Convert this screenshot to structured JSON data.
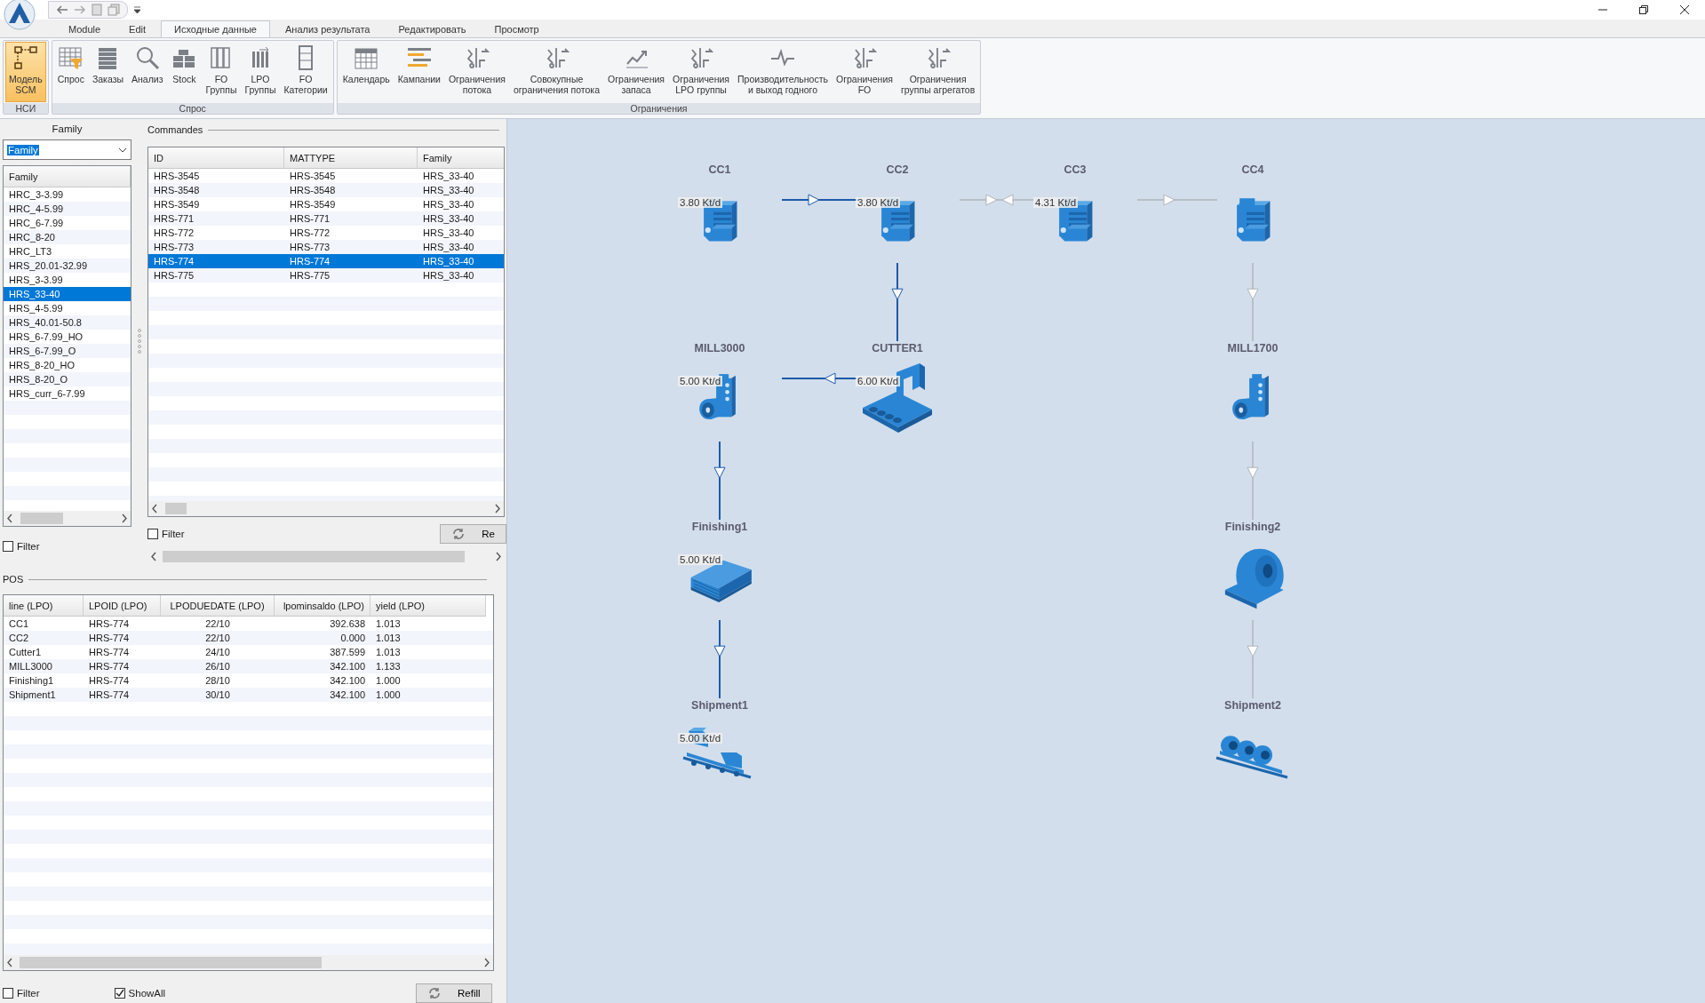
{
  "menu_tabs": [
    {
      "label": "Module",
      "selected": false
    },
    {
      "label": "Edit",
      "selected": false
    },
    {
      "label": "Исходные данные",
      "selected": true
    },
    {
      "label": "Анализ результата",
      "selected": false
    },
    {
      "label": "Редактировать",
      "selected": false
    },
    {
      "label": "Просмотр",
      "selected": false
    }
  ],
  "ribbon_groups": [
    {
      "title": "НСИ",
      "buttons": [
        {
          "kind": "model",
          "lines": [
            "Модель",
            "SCM"
          ],
          "selected": true
        }
      ]
    },
    {
      "title": "Спрос",
      "buttons": [
        {
          "kind": "table",
          "lines": [
            "Спрос"
          ],
          "selected": false
        },
        {
          "kind": "stack",
          "lines": [
            "Заказы"
          ],
          "selected": false
        },
        {
          "kind": "search",
          "lines": [
            "Анализ"
          ],
          "selected": false
        },
        {
          "kind": "stock",
          "lines": [
            "Stock"
          ],
          "selected": false
        },
        {
          "kind": "columns",
          "lines": [
            "FO",
            "Группы"
          ],
          "selected": false
        },
        {
          "kind": "bars",
          "lines": [
            "LPO",
            "Группы"
          ],
          "selected": false
        },
        {
          "kind": "cabinet",
          "lines": [
            "FO",
            "Категории"
          ],
          "selected": false
        }
      ]
    },
    {
      "title": "Ограничения",
      "buttons": [
        {
          "kind": "calendar",
          "lines": [
            "Календарь"
          ],
          "selected": false
        },
        {
          "kind": "gantt",
          "lines": [
            "Кампании"
          ],
          "selected": false
        },
        {
          "kind": "flow",
          "lines": [
            "Ограничения",
            "потока"
          ],
          "selected": false
        },
        {
          "kind": "flow",
          "lines": [
            "Совокупные",
            "ограничения потока"
          ],
          "selected": false
        },
        {
          "kind": "trend",
          "lines": [
            "Ограничения",
            "запаса"
          ],
          "selected": false
        },
        {
          "kind": "flow",
          "lines": [
            "Ограничения",
            "LPO группы"
          ],
          "selected": false
        },
        {
          "kind": "pulse",
          "lines": [
            "Производительность",
            "и выход годного"
          ],
          "selected": false
        },
        {
          "kind": "flow",
          "lines": [
            "Ограничения",
            "FO"
          ],
          "selected": false
        },
        {
          "kind": "flow",
          "lines": [
            "Ограничения",
            "группы агрегатов"
          ],
          "selected": false
        }
      ]
    }
  ],
  "family_panel": {
    "title": "Family",
    "select_value": "Family",
    "list_header": "Family",
    "items": [
      {
        "label": "HRC_3-3.99",
        "selected": false
      },
      {
        "label": "HRC_4-5.99",
        "selected": false
      },
      {
        "label": "HRC_6-7.99",
        "selected": false
      },
      {
        "label": "HRC_8-20",
        "selected": false
      },
      {
        "label": "HRC_LT3",
        "selected": false
      },
      {
        "label": "HRS_20.01-32.99",
        "selected": false
      },
      {
        "label": "HRS_3-3.99",
        "selected": false
      },
      {
        "label": "HRS_33-40",
        "selected": true
      },
      {
        "label": "HRS_4-5.99",
        "selected": false
      },
      {
        "label": "HRS_40.01-50.8",
        "selected": false
      },
      {
        "label": "HRS_6-7.99_HO",
        "selected": false
      },
      {
        "label": "HRS_6-7.99_O",
        "selected": false
      },
      {
        "label": "HRS_8-20_HO",
        "selected": false
      },
      {
        "label": "HRS_8-20_O",
        "selected": false
      },
      {
        "label": "HRS_curr_6-7.99",
        "selected": false
      }
    ],
    "filter": {
      "label": "Filter",
      "checked": false
    }
  },
  "commandes": {
    "title": "Commandes",
    "columns": [
      "ID",
      "MATTYPE",
      "Family"
    ],
    "rows": [
      {
        "cells": [
          "HRS-3545",
          "HRS-3545",
          "HRS_33-40"
        ],
        "selected": false
      },
      {
        "cells": [
          "HRS-3548",
          "HRS-3548",
          "HRS_33-40"
        ],
        "selected": false
      },
      {
        "cells": [
          "HRS-3549",
          "HRS-3549",
          "HRS_33-40"
        ],
        "selected": false
      },
      {
        "cells": [
          "HRS-771",
          "HRS-771",
          "HRS_33-40"
        ],
        "selected": false
      },
      {
        "cells": [
          "HRS-772",
          "HRS-772",
          "HRS_33-40"
        ],
        "selected": false
      },
      {
        "cells": [
          "HRS-773",
          "HRS-773",
          "HRS_33-40"
        ],
        "selected": false
      },
      {
        "cells": [
          "HRS-774",
          "HRS-774",
          "HRS_33-40"
        ],
        "selected": true
      },
      {
        "cells": [
          "HRS-775",
          "HRS-775",
          "HRS_33-40"
        ],
        "selected": false
      }
    ],
    "filter": {
      "label": "Filter",
      "checked": false
    },
    "refresh_button": "Re"
  },
  "pos": {
    "title": "POS",
    "columns": [
      "line (LPO)",
      "LPOID (LPO)",
      "LPODUEDATE (LPO)",
      "lpominsaldo (LPO)",
      "yield (LPO)"
    ],
    "rows": [
      [
        "CC1",
        "HRS-774",
        "22/10",
        "392.638",
        "1.013"
      ],
      [
        "CC2",
        "HRS-774",
        "22/10",
        "0.000",
        "1.013"
      ],
      [
        "Cutter1",
        "HRS-774",
        "24/10",
        "387.599",
        "1.013"
      ],
      [
        "MILL3000",
        "HRS-774",
        "26/10",
        "342.100",
        "1.133"
      ],
      [
        "Finishing1",
        "HRS-774",
        "28/10",
        "342.100",
        "1.000"
      ],
      [
        "Shipment1",
        "HRS-774",
        "30/10",
        "342.100",
        "1.000"
      ]
    ],
    "filter": {
      "label": "Filter",
      "checked": false
    },
    "show_all": {
      "label": "ShowAll",
      "checked": true
    },
    "refill_button": "Refill"
  },
  "diagram": {
    "rows": [
      [
        {
          "name": "CC1",
          "kind": "caster",
          "capacity": "3.80 Kt/d",
          "flow_right": {
            "active": true
          }
        },
        {
          "name": "CC2",
          "kind": "caster",
          "capacity": "3.80 Kt/d",
          "flow_right": {
            "active": false,
            "two_way": true
          },
          "flow_down": {
            "active": true
          }
        },
        {
          "name": "CC3",
          "kind": "caster",
          "capacity": "4.31 Kt/d",
          "flow_right": {
            "active": false
          }
        },
        {
          "name": "CC4",
          "kind": "caster",
          "flow_down": {
            "active": false
          }
        }
      ],
      [
        {
          "name": "MILL3000",
          "kind": "mill",
          "capacity": "5.00 Kt/d",
          "flow_down": {
            "active": true
          }
        },
        {
          "name": "CUTTER1",
          "kind": "cutter",
          "capacity": "6.00 Kt/d",
          "flow_left": {
            "active": true
          }
        },
        null,
        {
          "name": "MILL1700",
          "kind": "mill",
          "flow_down": {
            "active": false
          }
        }
      ],
      [
        {
          "name": "Finishing1",
          "kind": "pallet",
          "capacity": "5.00 Kt/d",
          "flow_down": {
            "active": true
          }
        },
        null,
        null,
        {
          "name": "Finishing2",
          "kind": "coil",
          "flow_down": {
            "active": false
          }
        }
      ],
      [
        {
          "name": "Shipment1",
          "kind": "wagon",
          "capacity": "5.00 Kt/d"
        },
        null,
        null,
        {
          "name": "Shipment2",
          "kind": "coil_wagon"
        }
      ]
    ]
  }
}
